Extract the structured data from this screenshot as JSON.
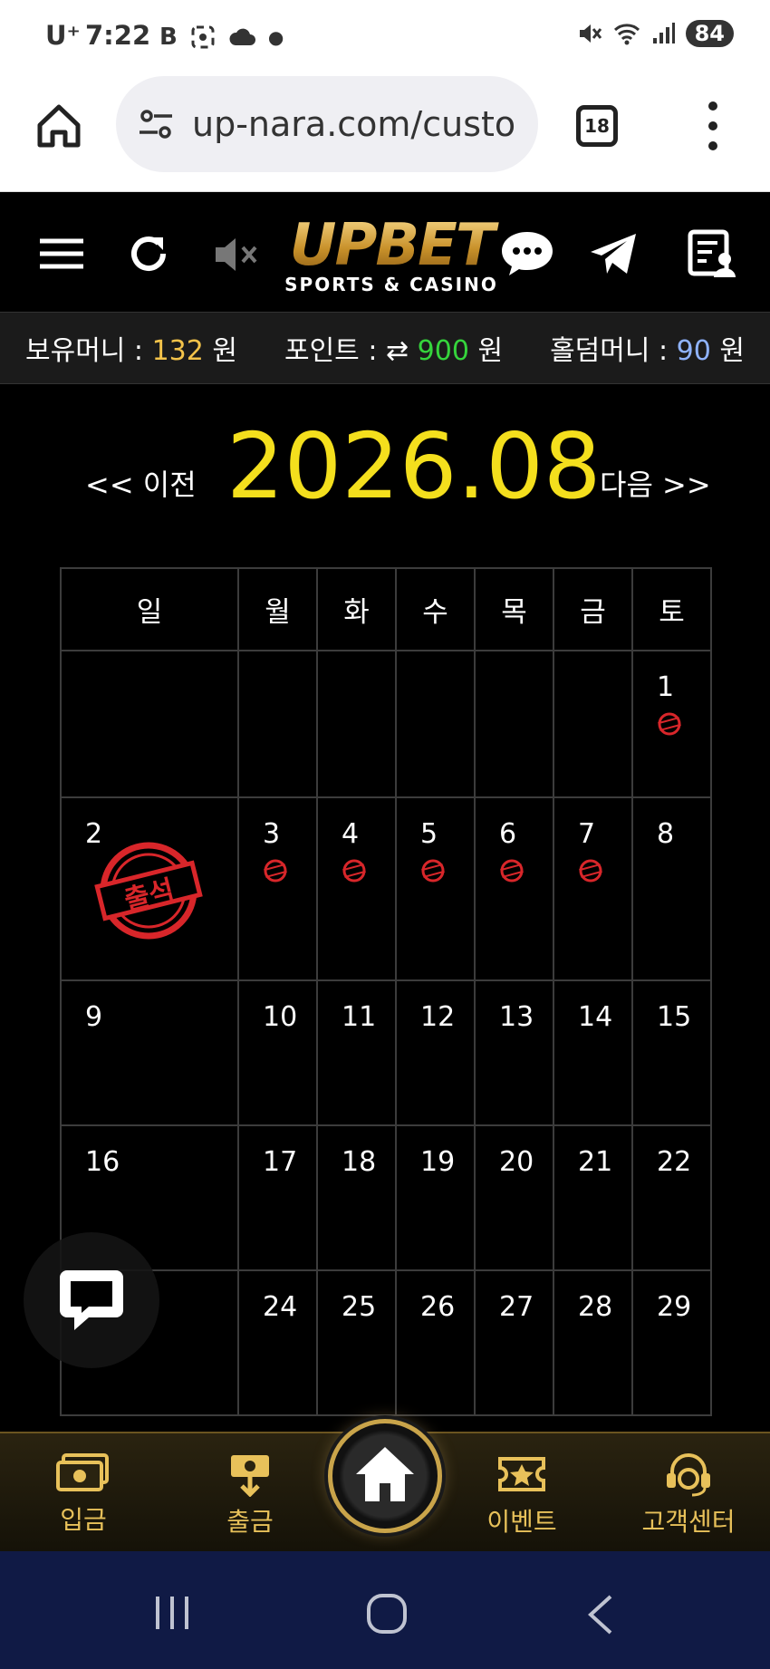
{
  "status_bar": {
    "carrier": "U⁺",
    "time": "7:22",
    "battery": "84"
  },
  "browser": {
    "url": "up-nara.com/custo",
    "tab_count": "18"
  },
  "logo": {
    "brand": "UPBET",
    "subtitle": "SPORTS & CASINO"
  },
  "balance": {
    "money_label": "보유머니 :",
    "money_value": "132",
    "money_unit": "원",
    "point_label": "포인트 :",
    "point_value": "900",
    "point_unit": "원",
    "holdem_label": "홀덤머니 :",
    "holdem_value": "90",
    "holdem_unit": "원"
  },
  "month_nav": {
    "prev": "<< 이전",
    "month": "2026.08",
    "next": "다음 >>"
  },
  "calendar": {
    "weekdays": [
      "일",
      "월",
      "화",
      "수",
      "목",
      "금",
      "토"
    ],
    "stamp_text": "출석"
  },
  "bottom_nav": {
    "deposit": "입금",
    "withdraw": "출금",
    "event": "이벤트",
    "support": "고객센터"
  },
  "colors": {
    "accent_gold": "#e8c15a",
    "month_yellow": "#f4df1d",
    "points_green": "#35d43c",
    "stamp_red": "#d8262a"
  }
}
